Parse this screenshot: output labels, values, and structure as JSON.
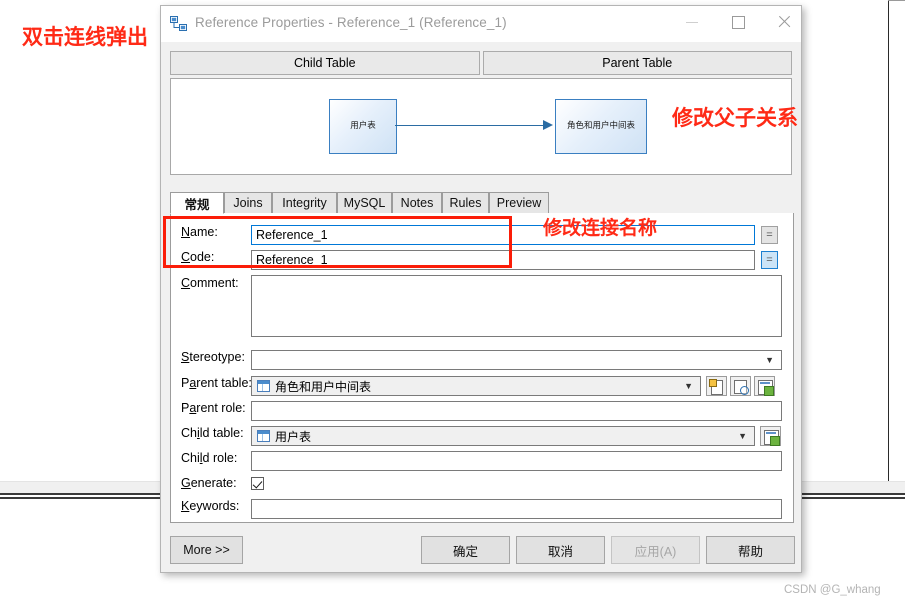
{
  "window": {
    "title": "Reference Properties - Reference_1 (Reference_1)",
    "icon": "reference-relationship-icon",
    "controls": {
      "minimize": "minimize-icon",
      "maximize": "maximize-icon",
      "close": "close-icon"
    }
  },
  "header_buttons": {
    "child_table": "Child Table",
    "parent_table": "Parent Table"
  },
  "diagram": {
    "child_box_label": "用户表",
    "parent_box_label": "角色和用户中间表",
    "link_direction": "child-to-parent",
    "box_border_color": "#3a7fc1"
  },
  "tabs": [
    {
      "label": "常规",
      "active": true
    },
    {
      "label": "Joins",
      "active": false
    },
    {
      "label": "Integrity",
      "active": false
    },
    {
      "label": "MySQL",
      "active": false
    },
    {
      "label": "Notes",
      "active": false
    },
    {
      "label": "Rules",
      "active": false
    },
    {
      "label": "Preview",
      "active": false
    }
  ],
  "form": {
    "name": {
      "label": "Name:",
      "value": "Reference_1",
      "button": "="
    },
    "code": {
      "label": "Code:",
      "value": "Reference_1",
      "button": "="
    },
    "comment": {
      "label": "Comment:",
      "value": ""
    },
    "stereotype": {
      "label": "Stereotype:",
      "value": ""
    },
    "parent_table": {
      "label": "Parent table:",
      "value": "角色和用户中间表",
      "icon": "table-icon",
      "buttons": [
        "new-document-icon",
        "browse-magnifier-icon",
        "properties-icon"
      ]
    },
    "parent_role": {
      "label": "Parent role:",
      "value": ""
    },
    "child_table": {
      "label": "Child table:",
      "value": "用户表",
      "icon": "table-icon",
      "buttons": [
        "properties-icon"
      ]
    },
    "child_role": {
      "label": "Child role:",
      "value": ""
    },
    "generate": {
      "label": "Generate:",
      "checked": true
    },
    "keywords": {
      "label": "Keywords:",
      "value": ""
    }
  },
  "buttons": {
    "more": "More >>",
    "ok": "确定",
    "cancel": "取消",
    "apply": "应用(A)",
    "apply_disabled": true,
    "help": "帮助"
  },
  "annotations": {
    "dblclick": "双击连线弹出",
    "parent_child": "修改父子关系",
    "rename": "修改连接名称",
    "accent_color": "#ff2a16"
  },
  "watermark": "CSDN @G_whang"
}
